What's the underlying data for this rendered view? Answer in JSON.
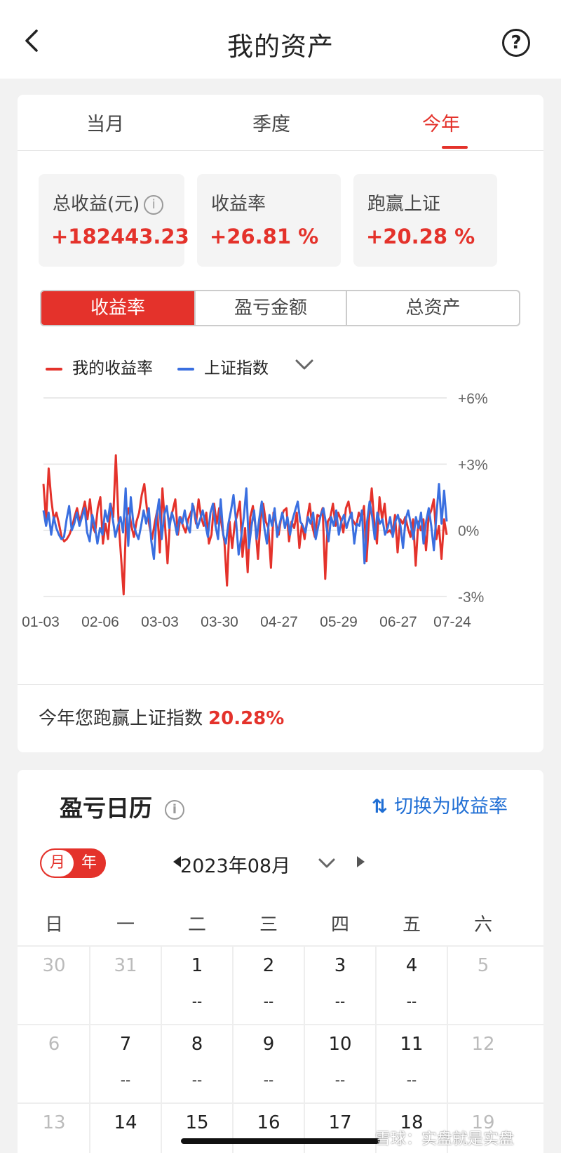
{
  "header": {
    "title": "我的资产"
  },
  "tabs": [
    {
      "label": "当月",
      "active": false
    },
    {
      "label": "季度",
      "active": false
    },
    {
      "label": "今年",
      "active": true
    }
  ],
  "stats": [
    {
      "label": "总收益(元)",
      "value": "+182443.23",
      "has_info": true
    },
    {
      "label": "收益率",
      "value": "+26.81 %"
    },
    {
      "label": "跑赢上证",
      "value": "+20.28 %"
    }
  ],
  "segment": {
    "options": [
      "收益率",
      "盈亏金额",
      "总资产"
    ],
    "active_index": 0
  },
  "legend": {
    "mine": "我的收益率",
    "index": "上证指数",
    "mine_color": "#e4322b",
    "index_color": "#3a6fe0"
  },
  "chart_data": {
    "type": "line",
    "x_ticks": [
      "01-03",
      "02-06",
      "03-03",
      "03-30",
      "04-27",
      "05-29",
      "06-27",
      "07-24"
    ],
    "y_ticks": [
      "+6%",
      "+3%",
      "0%",
      "-3%"
    ],
    "ylim": [
      -3,
      6
    ],
    "series": [
      {
        "name": "我的收益率",
        "color": "#e4322b",
        "values": [
          2.1,
          0.4,
          2.8,
          1.4,
          0.5,
          0.8,
          0.3,
          -0.3,
          -0.5,
          -0.4,
          -0.2,
          0.1,
          0.6,
          1.0,
          0.4,
          0.8,
          1.3,
          0.5,
          1.4,
          0.2,
          -0.1,
          1.0,
          1.5,
          -0.6,
          0.3,
          -0.4,
          1.2,
          0.6,
          3.4,
          0.5,
          -1.2,
          -2.9,
          0.5,
          1.0,
          0.2,
          -0.3,
          0.4,
          0.8,
          1.6,
          2.1,
          1.0,
          0.2,
          -0.4,
          0.3,
          0.9,
          -1.0,
          1.9,
          0.3,
          -1.5,
          0.5,
          0.9,
          1.4,
          -0.2,
          0.6,
          0.2,
          -0.1,
          0.5,
          0.8,
          1.1,
          0.3,
          1.4,
          0.6,
          0.2,
          0.8,
          -0.6,
          -0.2,
          1.2,
          0.3,
          1.0,
          0.2,
          -0.5,
          -2.5,
          0.4,
          -0.8,
          0.3,
          0.7,
          1.3,
          -1.2,
          0.1,
          -1.9,
          0.6,
          1.1,
          0.2,
          -1.3,
          0.5,
          1.2,
          0.4,
          0.1,
          -1.7,
          0.8,
          0.3,
          -0.2,
          0.6,
          0.9,
          1.0,
          -0.5,
          0.4,
          0.1,
          0.8,
          -0.8,
          0.3,
          -0.4,
          0.5,
          1.2,
          0.2,
          -0.3,
          0.7,
          0.6,
          1.0,
          -2.2,
          0.4,
          0.6,
          1.2,
          0.2,
          0.8,
          0.5,
          -0.1,
          1.0,
          1.3,
          0.6,
          0.4,
          0.2,
          0.8,
          0.5,
          1.1,
          -1.4,
          0.6,
          1.9,
          0.3,
          -0.6,
          1.5,
          0.5,
          1.2,
          -0.1,
          0.0,
          -0.2,
          0.7,
          -1.0,
          0.5,
          0.3,
          0.6,
          0.1,
          -0.3,
          0.5,
          -1.6,
          0.4,
          0.0,
          0.5,
          -0.9,
          0.6,
          0.9,
          1.4,
          -0.4,
          0.2,
          -1.3,
          0.5,
          -0.2
        ],
        "values_end_note": ""
      },
      {
        "name": "上证指数",
        "color": "#3a6fe0",
        "values": [
          0.9,
          0.2,
          0.8,
          -0.2,
          0.6,
          0.1,
          -0.2,
          -0.4,
          -0.3,
          0.5,
          1.1,
          0.0,
          0.3,
          0.8,
          0.2,
          0.6,
          1.0,
          -0.1,
          -0.5,
          0.7,
          0.2,
          -0.6,
          0.1,
          -0.2,
          0.9,
          0.4,
          1.2,
          0.5,
          -0.3,
          0.2,
          0.6,
          -0.1,
          1.9,
          -0.7,
          1.5,
          0.3,
          -0.1,
          -0.4,
          0.2,
          0.9,
          0.3,
          1.0,
          -0.5,
          -1.3,
          0.6,
          1.4,
          -0.4,
          0.7,
          1.1,
          0.1,
          0.8,
          0.4,
          -0.2,
          0.6,
          0.3,
          0.9,
          0.2,
          -0.1,
          1.2,
          0.7,
          0.1,
          0.5,
          0.9,
          0.3,
          -0.3,
          0.8,
          1.2,
          0.2,
          -0.4,
          1.4,
          -0.2,
          -0.6,
          0.3,
          0.9,
          1.6,
          0.4,
          -1.1,
          -0.3,
          0.6,
          1.9,
          -0.8,
          0.2,
          0.9,
          -0.4,
          0.5,
          1.3,
          0.1,
          -0.6,
          0.7,
          0.2,
          1.0,
          -0.3,
          0.3,
          0.8,
          0.1,
          0.6,
          -0.2,
          0.5,
          0.9,
          1.3,
          0.4,
          0.2,
          -0.1,
          0.6,
          0.3,
          0.8,
          -0.4,
          0.2,
          0.7,
          1.0,
          0.3,
          -0.5,
          0.6,
          0.2,
          0.9,
          -0.2,
          0.4,
          0.7,
          0.1,
          0.5,
          0.8,
          -0.6,
          0.3,
          0.2,
          0.9,
          -1.5,
          0.4,
          1.3,
          0.6,
          -0.4,
          0.8,
          0.3,
          0.5,
          -0.2,
          0.1,
          0.6,
          -0.3,
          0.4,
          0.7,
          0.2,
          -0.8,
          0.5,
          0.9,
          0.3,
          -0.4,
          0.6,
          0.1,
          0.8,
          -0.6,
          0.4,
          1.0,
          0.2,
          -0.9,
          0.7,
          2.1,
          0.3,
          1.8,
          0.4
        ]
      }
    ]
  },
  "footer": {
    "text": "今年您跑赢上证指数",
    "value": "20.28%"
  },
  "calendar": {
    "title": "盈亏日历",
    "switch_label": "切换为收益率",
    "toggle": {
      "month": "月",
      "year": "年"
    },
    "month_label": "2023年08月",
    "weekdays": [
      "日",
      "一",
      "二",
      "三",
      "四",
      "五",
      "六"
    ],
    "rows": [
      [
        {
          "d": "30",
          "gray": true,
          "v": ""
        },
        {
          "d": "31",
          "gray": true,
          "v": ""
        },
        {
          "d": "1",
          "gray": false,
          "v": "--"
        },
        {
          "d": "2",
          "gray": false,
          "v": "--"
        },
        {
          "d": "3",
          "gray": false,
          "v": "--"
        },
        {
          "d": "4",
          "gray": false,
          "v": "--"
        },
        {
          "d": "5",
          "gray": true,
          "v": ""
        }
      ],
      [
        {
          "d": "6",
          "gray": true,
          "v": ""
        },
        {
          "d": "7",
          "gray": false,
          "v": "--"
        },
        {
          "d": "8",
          "gray": false,
          "v": "--"
        },
        {
          "d": "9",
          "gray": false,
          "v": "--"
        },
        {
          "d": "10",
          "gray": false,
          "v": "--"
        },
        {
          "d": "11",
          "gray": false,
          "v": "--"
        },
        {
          "d": "12",
          "gray": true,
          "v": ""
        }
      ],
      [
        {
          "d": "13",
          "gray": true,
          "v": ""
        },
        {
          "d": "14",
          "gray": false,
          "v": ""
        },
        {
          "d": "15",
          "gray": false,
          "v": ""
        },
        {
          "d": "16",
          "gray": false,
          "v": ""
        },
        {
          "d": "17",
          "gray": false,
          "v": ""
        },
        {
          "d": "18",
          "gray": false,
          "v": ""
        },
        {
          "d": "19",
          "gray": true,
          "v": ""
        }
      ]
    ]
  },
  "watermark": "雪球：实盘就是实盘"
}
